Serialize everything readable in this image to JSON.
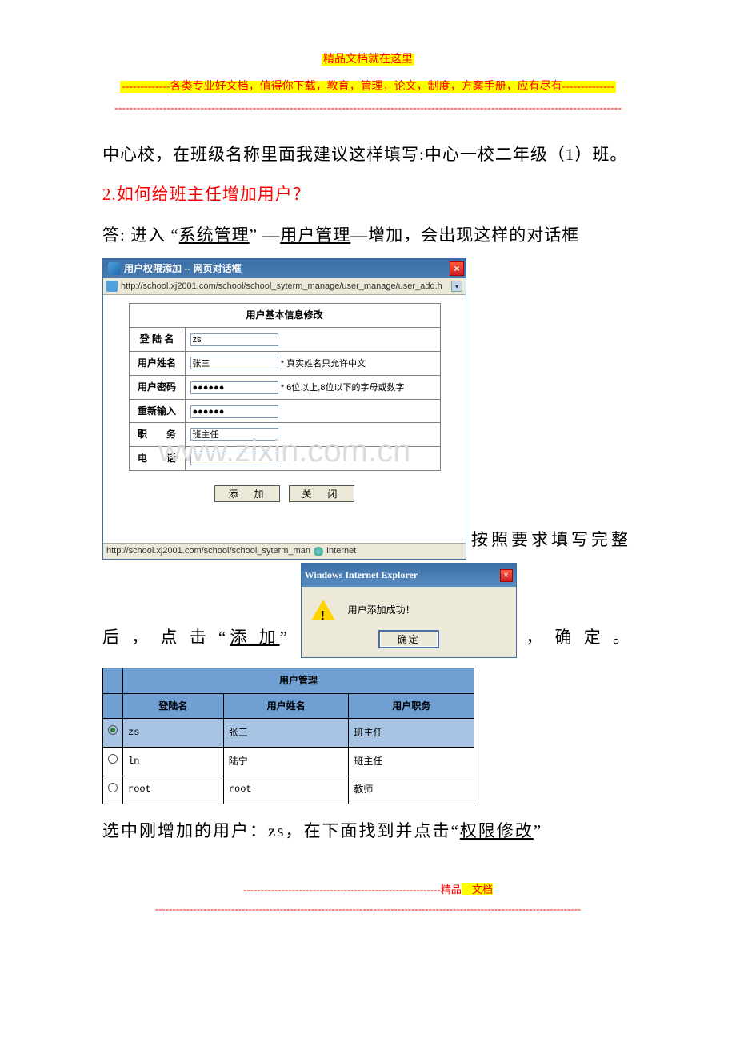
{
  "header": {
    "line1": "精品文档就在这里",
    "line2": "-------------各类专业好文档，值得你下载，教育，管理，论文，制度，方案手册，应有尽有--------------",
    "line3": "----------------------------------------------------------------------------------------------------------------------------------------"
  },
  "para1": "中心校，在班级名称里面我建议这样填写:中心一校二年级（1）班。",
  "q2_num": "2.",
  "q2_text": "如何给班主任增加用户",
  "q2_mark": "？",
  "answer_prefix": "答: 进入 “",
  "link_sys": "系统管理",
  "answer_mid1": "” —",
  "link_user": "用户管理",
  "answer_mid2": "—增加，会出现这样的对话框",
  "dialog": {
    "title": "用户权限添加 -- 网页对话框",
    "url": "http://school.xj2001.com/school/school_syterm_manage/user_manage/user_add.h",
    "form_title": "用户基本信息修改",
    "rows": {
      "login_label": "登 陆 名",
      "login_value": "zs",
      "name_label": "用户姓名",
      "name_value": "张三",
      "name_hint": "* 真实姓名只允许中文",
      "pwd_label": "用户密码",
      "pwd_value": "●●●●●●",
      "pwd_hint": "* 6位以上,8位以下的字母或数字",
      "re_label": "重新输入",
      "re_value": "●●●●●●",
      "job_label": "职　　务",
      "job_value": "班主任",
      "tel_label": "电　　话"
    },
    "btn_add": "添　加",
    "btn_close": "关　闭",
    "status_url": "http://school.xj2001.com/school/school_syterm_man",
    "zone": "Internet"
  },
  "tail1": "按照要求填写完整",
  "para3_a": "后 ， 点 击 “",
  "link_add": "添 加",
  "para3_b": "”",
  "para3_c": "， 确 定 。",
  "alert": {
    "title": "Windows Internet Explorer",
    "msg": "用户添加成功！",
    "ok": "确定"
  },
  "user_table": {
    "title": "用户管理",
    "cols": {
      "login": "登陆名",
      "name": "用户姓名",
      "job": "用户职务"
    },
    "rows": [
      {
        "login": "zs",
        "name": "张三",
        "job": "班主任",
        "selected": true
      },
      {
        "login": "ln",
        "name": "陆宁",
        "job": "班主任",
        "selected": false
      },
      {
        "login": "root",
        "name": "root",
        "job": "教师",
        "selected": false
      }
    ]
  },
  "para4_a": "选中刚增加的用户：zs，在下面找到并点击“",
  "link_perm": "权限修改",
  "para4_b": "”",
  "footer": {
    "f1": "---------------------------------------------------------精品",
    "f1b": "　文档",
    "f2": "---------------------------------------------------------------------------------------------------------------------------"
  },
  "watermark": "www.zixin.com.cn"
}
